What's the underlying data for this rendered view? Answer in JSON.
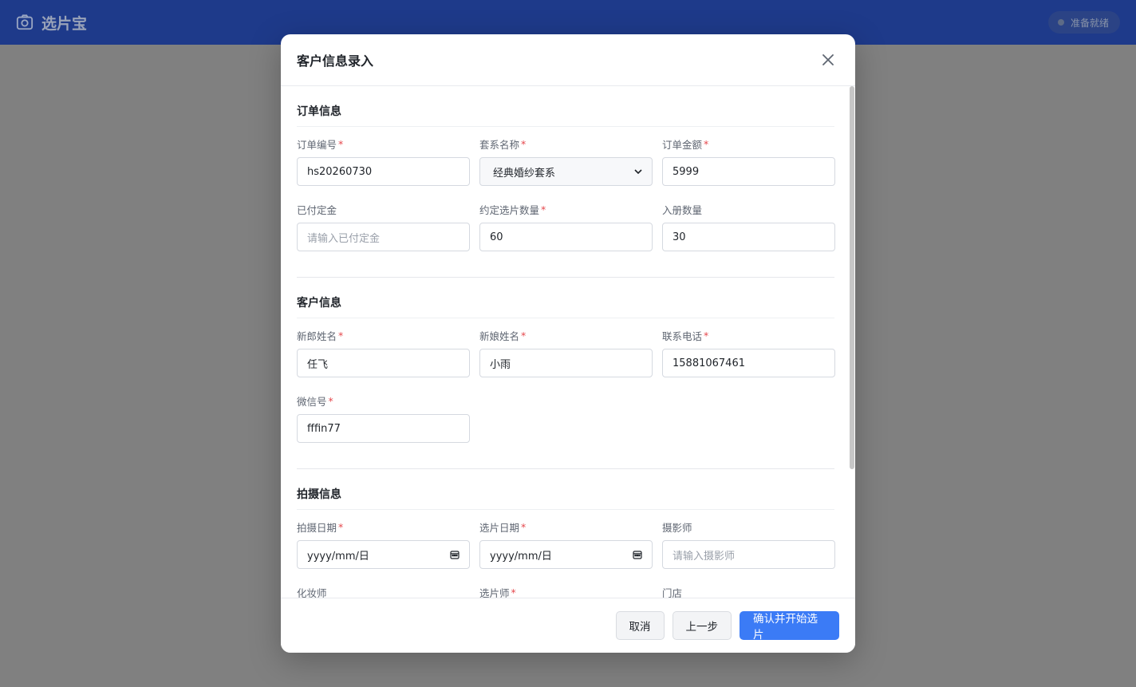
{
  "app": {
    "title": "选片宝",
    "status": "准备就绪"
  },
  "modal": {
    "title": "客户信息录入",
    "sections": {
      "order": {
        "title": "订单信息",
        "order_no": {
          "label": "订单编号",
          "value": "hs20260730"
        },
        "package": {
          "label": "套系名称",
          "value": "经典婚纱套系"
        },
        "amount": {
          "label": "订单金额",
          "value": "5999"
        },
        "deposit": {
          "label": "已付定金",
          "placeholder": "请输入已付定金"
        },
        "select_count": {
          "label": "约定选片数量",
          "value": "60"
        },
        "album_count": {
          "label": "入册数量",
          "value": "30"
        }
      },
      "customer": {
        "title": "客户信息",
        "groom": {
          "label": "新郎姓名",
          "value": "任飞"
        },
        "bride": {
          "label": "新娘姓名",
          "value": "小雨"
        },
        "phone": {
          "label": "联系电话",
          "value": "15881067461"
        },
        "wechat": {
          "label": "微信号",
          "value": "fffin77"
        }
      },
      "shoot": {
        "title": "拍摄信息",
        "shoot_date": {
          "label": "拍摄日期",
          "placeholder": "yyyy/mm/日"
        },
        "select_date": {
          "label": "选片日期",
          "placeholder": "yyyy/mm/日"
        },
        "photographer": {
          "label": "摄影师",
          "placeholder": "请输入摄影师"
        },
        "makeup": {
          "label": "化妆师"
        },
        "selector": {
          "label": "选片师"
        },
        "store": {
          "label": "门店"
        }
      }
    },
    "footer": {
      "cancel": "取消",
      "prev": "上一步",
      "confirm": "确认并开始选片"
    }
  },
  "colors": {
    "header_bg": "#1e3a8a",
    "primary": "#3b7bf6",
    "required": "#e5484d"
  }
}
